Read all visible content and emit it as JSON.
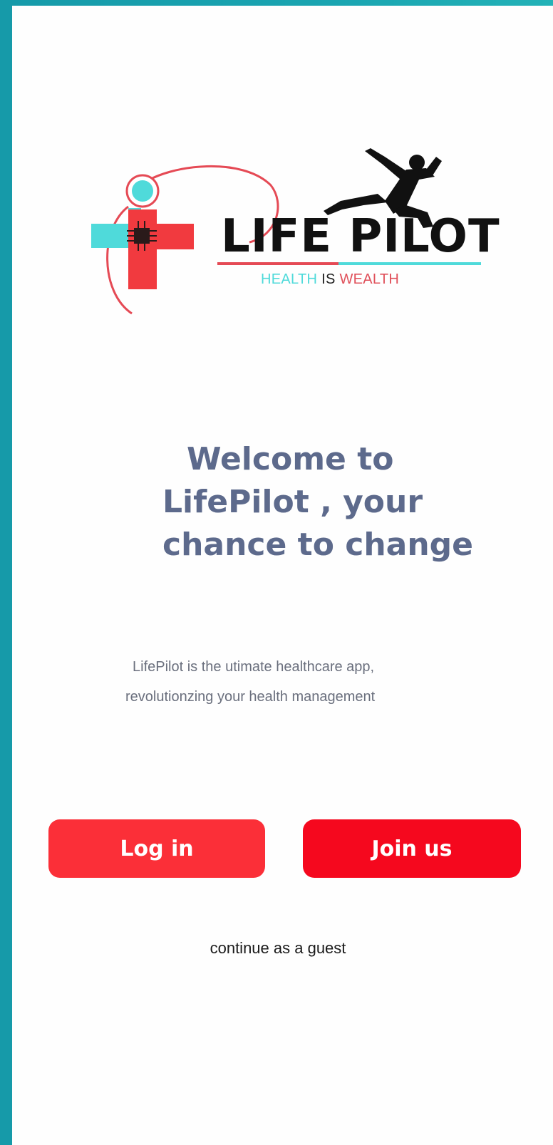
{
  "logo": {
    "brand_name": "LIFE PILOT",
    "tagline_part1": "HEALTH",
    "tagline_part2": "IS",
    "tagline_part3": "WEALTH"
  },
  "welcome": {
    "line1": "Welcome to",
    "line2": "LifePilot , your",
    "line3": "chance to change"
  },
  "description": {
    "line1": "LifePilot is the utimate healthcare app,",
    "line2": "revolutionzing your health management"
  },
  "actions": {
    "login_label": "Log in",
    "join_label": "Join us",
    "guest_label": "continue as a guest"
  },
  "colors": {
    "frame": "#1aa5b1",
    "heading": "#5d6a8c",
    "login_button": "#fb2f38",
    "join_button": "#f5081e",
    "tagline_health": "#4fdada",
    "tagline_wealth": "#e0505a",
    "logo_red": "#f13a3f",
    "logo_teal": "#4fdada"
  }
}
